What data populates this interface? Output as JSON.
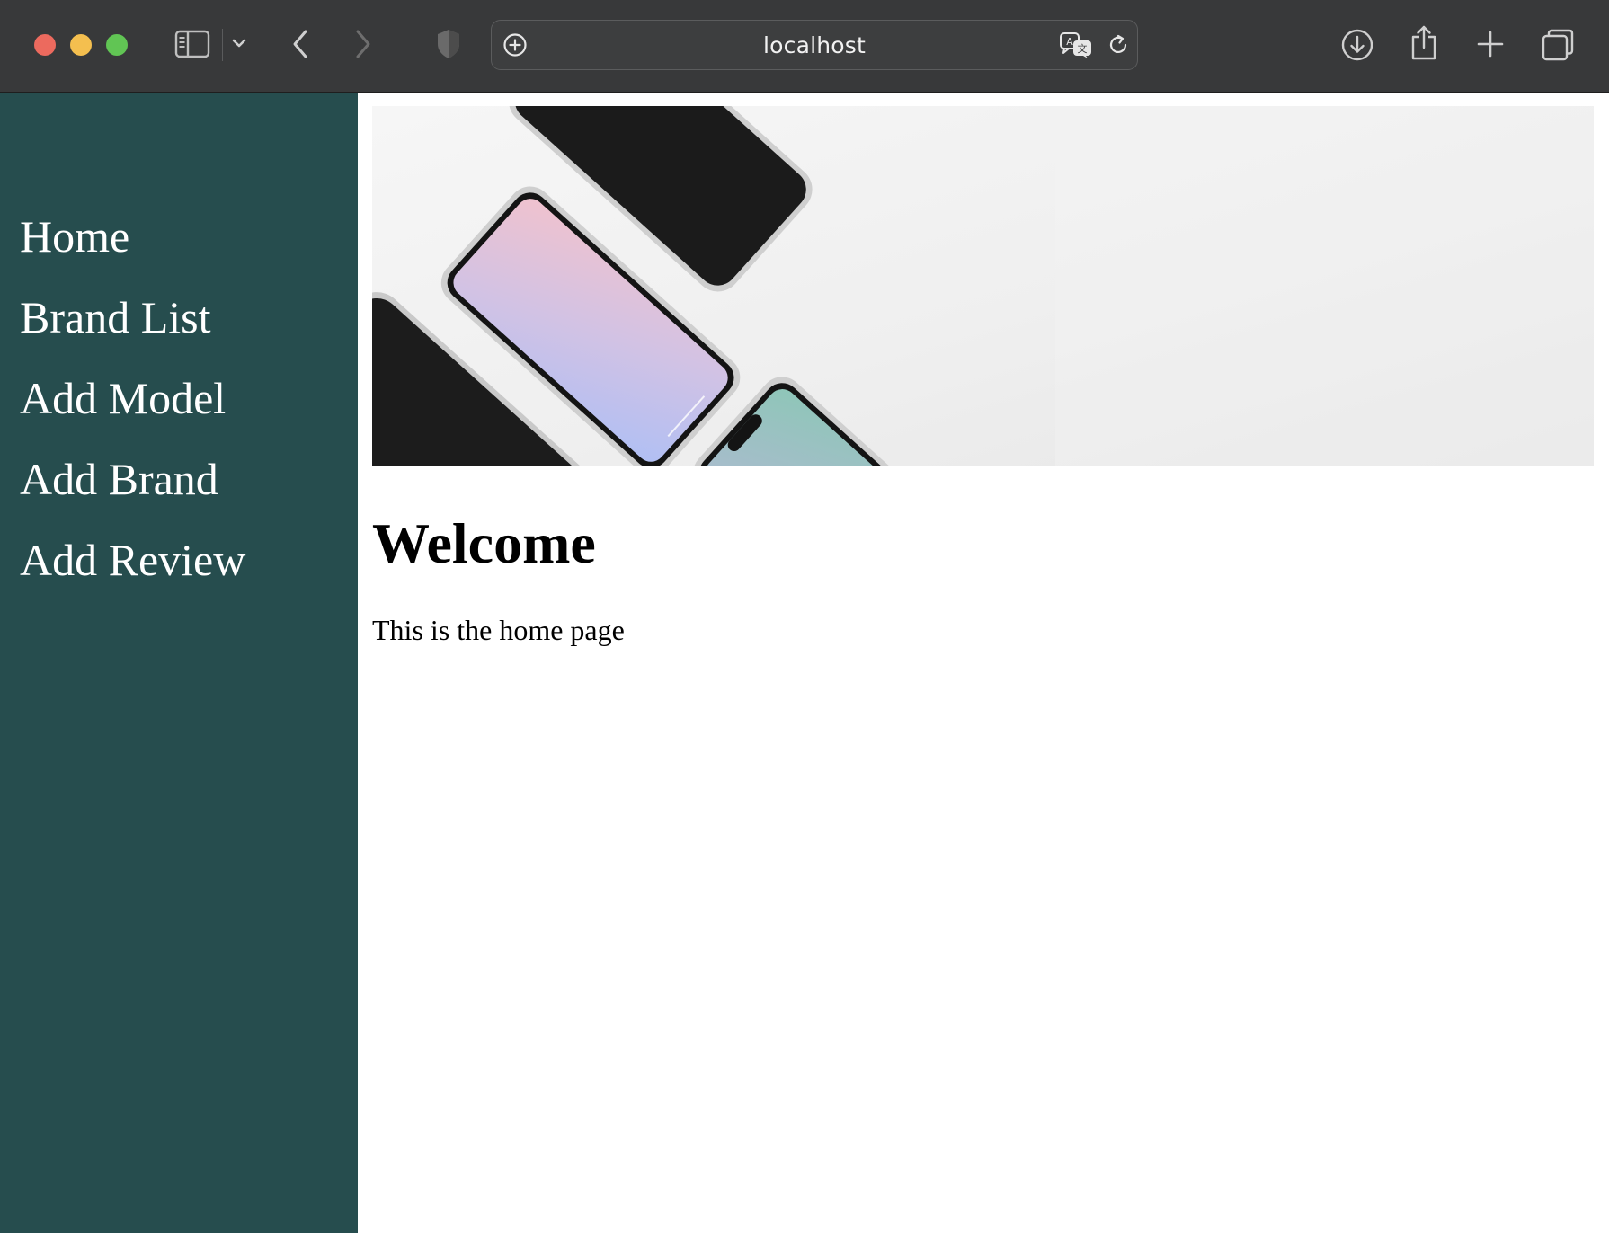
{
  "browser": {
    "address": "localhost",
    "toolbar_icons": [
      "sidebar-toggle-icon",
      "chevron-down-icon",
      "back-icon",
      "forward-icon",
      "privacy-shield-icon",
      "page-settings-icon",
      "translate-icon",
      "reload-icon",
      "downloads-icon",
      "share-icon",
      "new-tab-icon",
      "tab-overview-icon"
    ]
  },
  "sidebar": {
    "items": [
      {
        "label": "Home"
      },
      {
        "label": "Brand List"
      },
      {
        "label": "Add Model"
      },
      {
        "label": "Add Brand"
      },
      {
        "label": "Add Review"
      }
    ]
  },
  "main": {
    "hero_image": "phones-banner",
    "title": "Welcome",
    "description": "This is the home page"
  },
  "colors": {
    "sidebar_bg": "#264d4e",
    "chrome_bg": "#38393a",
    "page_bg": "#ffffff"
  }
}
